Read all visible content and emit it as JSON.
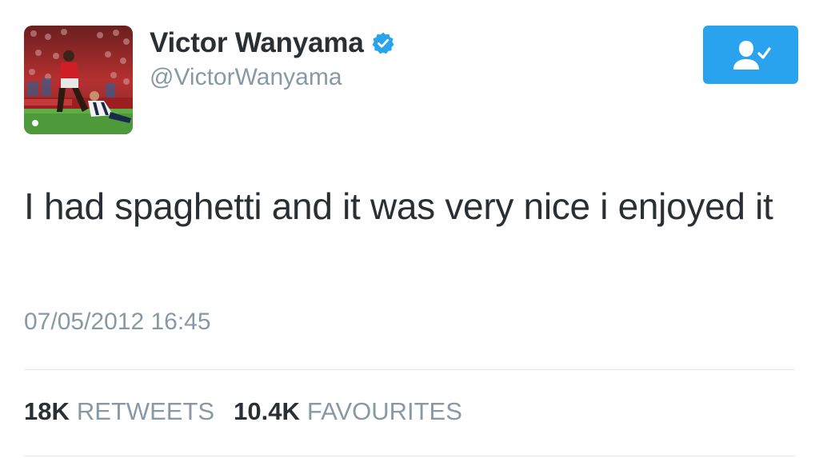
{
  "tweet": {
    "display_name": "Victor Wanyama",
    "handle": "@VictorWanyama",
    "text": "I had spaghetti and it was very nice i enjoyed it",
    "timestamp": "07/05/2012 16:45",
    "verified": true
  },
  "stats": {
    "retweets_count": "18K",
    "retweets_label": "RETWEETS",
    "favourites_count": "10.4K",
    "favourites_label": "FAVOURITES"
  },
  "icons": {
    "verified": "verified-badge-icon",
    "follow": "following-user-check-icon"
  },
  "colors": {
    "accent": "#2aa3ef",
    "secondary_text": "#8899a6",
    "primary_text": "#292f33"
  }
}
